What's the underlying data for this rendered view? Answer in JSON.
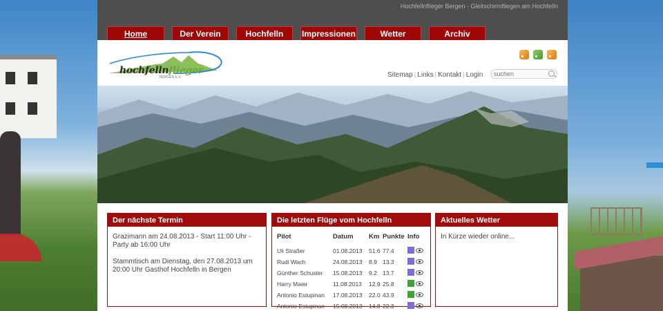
{
  "site": {
    "tagline": "Hochfellnflieger Bergen - Gleitschirmfliegen am Hochfelln"
  },
  "nav": {
    "tabs": [
      {
        "label": "Home",
        "active": true
      },
      {
        "label": "Der Verein",
        "active": false
      },
      {
        "label": "Hochfelln",
        "active": false
      },
      {
        "label": "Impressionen",
        "active": false
      },
      {
        "label": "Wetter",
        "active": false
      },
      {
        "label": "Archiv",
        "active": false
      }
    ]
  },
  "logo": {
    "text_main": "hochfelln",
    "text_accent": "flieger",
    "subtitle": "BERGEN E.V."
  },
  "feeds": [
    {
      "icon": "rss-icon",
      "color": "#e8891f"
    },
    {
      "icon": "rss-icon",
      "color": "#4b9a2d"
    },
    {
      "icon": "rss-icon",
      "color": "#e8891f"
    }
  ],
  "toplinks": [
    "Sitemap",
    "Links",
    "Kontakt",
    "Login"
  ],
  "search": {
    "placeholder": "suchen"
  },
  "boxes": {
    "termin": {
      "title": "Der nächste Termin",
      "paragraphs": [
        "Grazimann am 24.08.2013 - Start 11:00 Uhr - Party ab 16:00 Uhr",
        "Stammtisch am Dienstag, den 27.08.2013 um 20:00 Uhr Gasthof Hochfelln in Bergen"
      ]
    },
    "fluege": {
      "title": "Die letzten Flüge vom Hochfelln",
      "columns": [
        "Pilot",
        "Datum",
        "Km",
        "Punkte",
        "Info"
      ],
      "rows": [
        {
          "pilot": "Uli Straßer",
          "datum": "01.08.2013",
          "km": "51.6",
          "punkte": "77.4",
          "type": "purple"
        },
        {
          "pilot": "Rudi Wach",
          "datum": "24.08.2013",
          "km": "8.9",
          "punkte": "13.3",
          "type": "purple"
        },
        {
          "pilot": "Günther Schuster",
          "datum": "15.08.2013",
          "km": "9.2",
          "punkte": "13.7",
          "type": "purple"
        },
        {
          "pilot": "Harry Maier",
          "datum": "11.08.2013",
          "km": "12.9",
          "punkte": "25.8",
          "type": "green"
        },
        {
          "pilot": "Antonio Estupinan",
          "datum": "17.08.2013",
          "km": "22.0",
          "punkte": "43.9",
          "type": "green"
        },
        {
          "pilot": "Antonio Estupinan",
          "datum": "15.08.2013",
          "km": "14.8",
          "punkte": "22.3",
          "type": "purple"
        }
      ]
    },
    "wetter": {
      "title": "Aktuelles Wetter",
      "text": "In Kürze wieder online..."
    }
  },
  "colors": {
    "brand_red": "#a00b0b",
    "topbar": "#4e4e4e",
    "logo_green": "#6aa83c",
    "logo_blue": "#2a8ad0"
  }
}
